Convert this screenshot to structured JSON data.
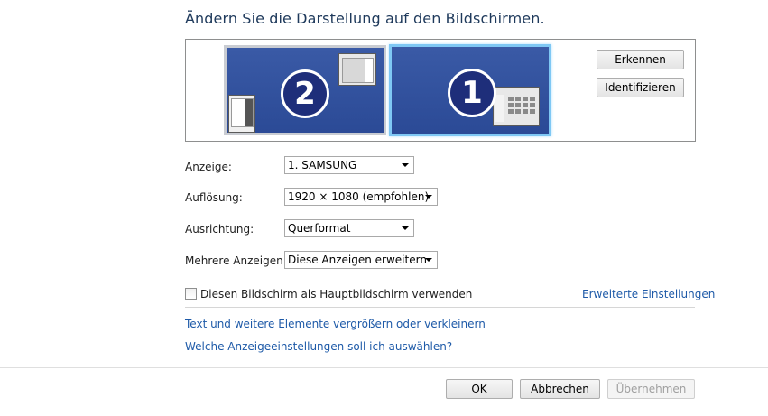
{
  "page": {
    "title": "Ändern Sie die Darstellung auf den Bildschirmen."
  },
  "monitors": {
    "left_number": "2",
    "right_number": "1",
    "detect_label": "Erkennen",
    "identify_label": "Identifizieren"
  },
  "settings": {
    "display_label": "Anzeige:",
    "display_value": "1. SAMSUNG",
    "resolution_label": "Auflösung:",
    "resolution_value": "1920 × 1080 (empfohlen)",
    "orientation_label": "Ausrichtung:",
    "orientation_value": "Querformat",
    "multiple_label": "Mehrere Anzeigen:",
    "multiple_value": "Diese Anzeigen erweitern"
  },
  "main_display": {
    "checkbox_label": "Diesen Bildschirm als Hauptbildschirm verwenden",
    "checked": false,
    "advanced_link": "Erweiterte Einstellungen"
  },
  "links": {
    "text_size": "Text und weitere Elemente vergrößern oder verkleinern",
    "which_settings": "Welche Anzeigeeinstellungen soll ich auswählen?"
  },
  "footer": {
    "ok_label": "OK",
    "cancel_label": "Abbrechen",
    "apply_label": "Übernehmen"
  },
  "colors": {
    "title": "#1e395b",
    "link": "#1e5aa8",
    "monitor_selected_border": "#7fc8f4"
  }
}
